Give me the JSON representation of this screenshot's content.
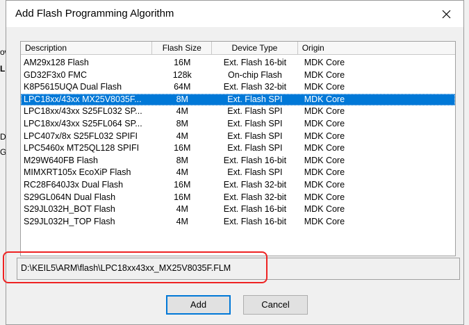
{
  "dialog": {
    "title": "Add Flash Programming Algorithm"
  },
  "columns": {
    "description": "Description",
    "flash_size": "Flash Size",
    "device_type": "Device Type",
    "origin": "Origin"
  },
  "rows": [
    {
      "description": "AM29x128 Flash",
      "size": "16M",
      "type": "Ext. Flash 16-bit",
      "origin": "MDK Core",
      "selected": false
    },
    {
      "description": "GD32F3x0 FMC",
      "size": "128k",
      "type": "On-chip Flash",
      "origin": "MDK Core",
      "selected": false
    },
    {
      "description": "K8P5615UQA Dual Flash",
      "size": "64M",
      "type": "Ext. Flash 32-bit",
      "origin": "MDK Core",
      "selected": false
    },
    {
      "description": "LPC18xx/43xx MX25V8035F...",
      "size": "8M",
      "type": "Ext. Flash SPI",
      "origin": "MDK Core",
      "selected": true
    },
    {
      "description": "LPC18xx/43xx S25FL032 SP...",
      "size": "4M",
      "type": "Ext. Flash SPI",
      "origin": "MDK Core",
      "selected": false
    },
    {
      "description": "LPC18xx/43xx S25FL064 SP...",
      "size": "8M",
      "type": "Ext. Flash SPI",
      "origin": "MDK Core",
      "selected": false
    },
    {
      "description": "LPC407x/8x S25FL032 SPIFI",
      "size": "4M",
      "type": "Ext. Flash SPI",
      "origin": "MDK Core",
      "selected": false
    },
    {
      "description": "LPC5460x MT25QL128 SPIFI",
      "size": "16M",
      "type": "Ext. Flash SPI",
      "origin": "MDK Core",
      "selected": false
    },
    {
      "description": "M29W640FB Flash",
      "size": "8M",
      "type": "Ext. Flash 16-bit",
      "origin": "MDK Core",
      "selected": false
    },
    {
      "description": "MIMXRT105x EcoXiP Flash",
      "size": "4M",
      "type": "Ext. Flash SPI",
      "origin": "MDK Core",
      "selected": false
    },
    {
      "description": "RC28F640J3x Dual Flash",
      "size": "16M",
      "type": "Ext. Flash 32-bit",
      "origin": "MDK Core",
      "selected": false
    },
    {
      "description": "S29GL064N Dual Flash",
      "size": "16M",
      "type": "Ext. Flash 32-bit",
      "origin": "MDK Core",
      "selected": false
    },
    {
      "description": "S29JL032H_BOT Flash",
      "size": "4M",
      "type": "Ext. Flash 16-bit",
      "origin": "MDK Core",
      "selected": false
    },
    {
      "description": "S29JL032H_TOP Flash",
      "size": "4M",
      "type": "Ext. Flash 16-bit",
      "origin": "MDK Core",
      "selected": false
    }
  ],
  "path": "D:\\KEIL5\\ARM\\flash\\LPC18xx43xx_MX25V8035F.FLM",
  "buttons": {
    "add": "Add",
    "cancel": "Cancel"
  },
  "background": {
    "fragments": [
      "ow",
      "L",
      "D",
      "G"
    ]
  },
  "colors": {
    "selection": "#0078d7",
    "highlight": "#ee2222"
  }
}
